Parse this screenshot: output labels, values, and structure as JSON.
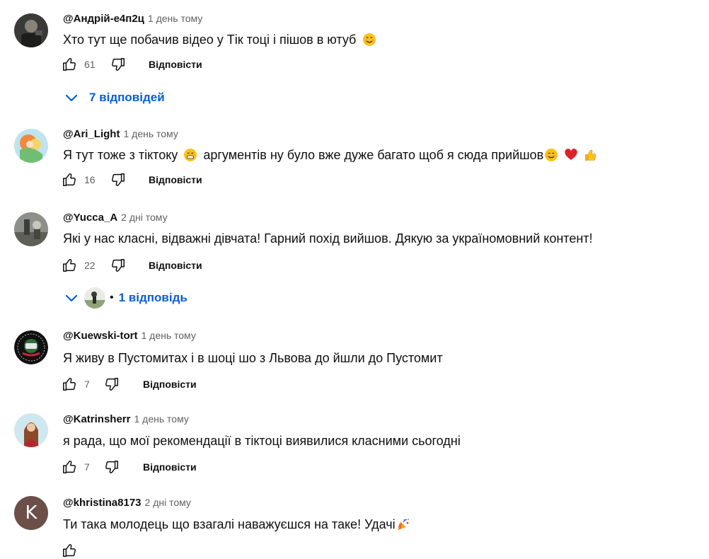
{
  "colors": {
    "link_blue": "#065fd4",
    "muted": "#606060",
    "text": "#0f0f0f"
  },
  "comments": [
    {
      "author": "@Андрій-е4п2ц",
      "time": "1 день тому",
      "text": "Хто тут ще побачив відео у Тік тоці і пішов в ютуб",
      "emoji": [
        "smiling-face-icon"
      ],
      "likes": "61",
      "reply_label": "Відповісти",
      "replies_label": "7 відповідей"
    },
    {
      "author": "@Ari_Light",
      "time": "1 день тому",
      "text_parts": [
        "Я тут тоже з тіктоку",
        "аргументів ну було вже дуже багато щоб я сюда прийшов"
      ],
      "emoji": [
        "grinning-face-icon",
        "smiling-face-icon",
        "red-heart-icon",
        "thumbs-up-icon"
      ],
      "likes": "16",
      "reply_label": "Відповісти"
    },
    {
      "author": "@Yucca_A",
      "time": "2 дні тому",
      "text": "Які у нас класні, відважні дівчата! Гарний похід вийшов. Дякую за україномовний контент!",
      "likes": "22",
      "reply_label": "Відповісти",
      "replies_label": "1 відповідь"
    },
    {
      "author": "@Kuewski-tort",
      "time": "1 день тому",
      "text": "Я живу в Пустомитах і в шоці шо з Львова до йшли до Пустомит",
      "likes": "7",
      "reply_label": "Відповісти"
    },
    {
      "author": "@Katrinsherr",
      "time": "1 день тому",
      "text": "я рада, що мої рекомендації в тіктоці виявилися класними сьогодні",
      "likes": "7",
      "reply_label": "Відповісти"
    },
    {
      "author": "@khristina8173",
      "time": "2 дні тому",
      "avatar_letter": "K",
      "text": "Ти така молодець що взагалі наважуєшся на таке! Удачі",
      "emoji": [
        "party-popper-icon"
      ]
    }
  ]
}
